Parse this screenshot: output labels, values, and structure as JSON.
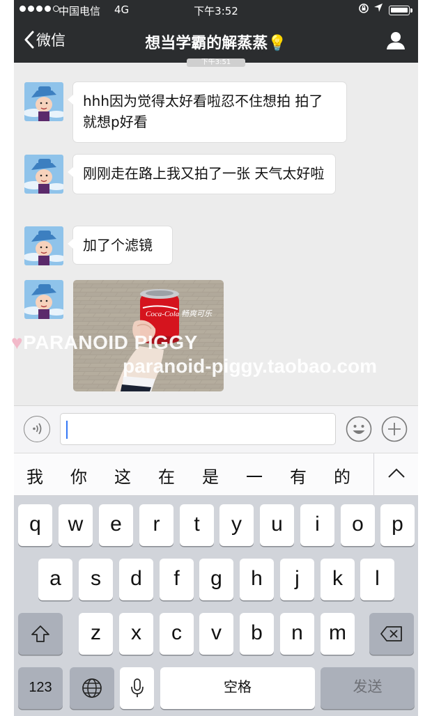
{
  "status_bar": {
    "carrier": "中国电信",
    "network": "4G",
    "time": "下午3:52"
  },
  "nav": {
    "back_label": "微信",
    "title": "想当学霸的解蒸蒸",
    "title_emoji": "💡"
  },
  "timestamp": "下午3:51",
  "messages": [
    {
      "type": "text",
      "text": "hhh因为觉得太好看啦忍不住想拍 拍了就想p好看"
    },
    {
      "type": "text",
      "text": "刚刚走在路上我又拍了一张 天气太好啦"
    },
    {
      "type": "text",
      "text": "加了个滤镜"
    },
    {
      "type": "image",
      "can_label": "Coca-Cola 畅爽可乐"
    }
  ],
  "watermark": {
    "line1": "PARANOID PIGGY",
    "line2": "paranoid-piggy.taobao.com"
  },
  "input": {
    "value": ""
  },
  "candidates": [
    "我",
    "你",
    "这",
    "在",
    "是",
    "一",
    "有",
    "的"
  ],
  "keyboard": {
    "row1": [
      "q",
      "w",
      "e",
      "r",
      "t",
      "y",
      "u",
      "i",
      "o",
      "p"
    ],
    "row2": [
      "a",
      "s",
      "d",
      "f",
      "g",
      "h",
      "j",
      "k",
      "l"
    ],
    "row3": [
      "z",
      "x",
      "c",
      "v",
      "b",
      "n",
      "m"
    ],
    "numbers_label": "123",
    "space_label": "空格",
    "send_label": "发送"
  },
  "colors": {
    "nav_background": "#2b2d2f",
    "chat_background": "#ececec",
    "keyboard_background": "#d1d4da",
    "caret": "#3478f6"
  }
}
